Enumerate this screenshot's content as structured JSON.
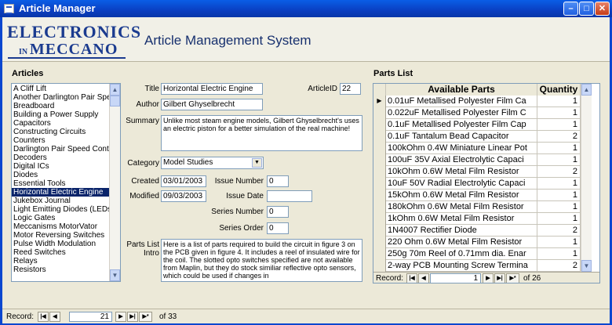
{
  "window": {
    "title": "Article Manager"
  },
  "header": {
    "logo_line1": "ELECTRONICS",
    "logo_in": "IN",
    "logo_line2": "MECCANO",
    "app_title": "Article Management System"
  },
  "articles": {
    "heading": "Articles",
    "items": [
      "A Cliff Lift",
      "Another Darlington Pair Speed",
      "Breadboard",
      "Building a Power Supply",
      "Capacitors",
      "Constructing Circuits",
      "Counters",
      "Darlington Pair Speed Control",
      "Decoders",
      "Digital ICs",
      "Diodes",
      "Essential Tools",
      "Horizontal Electric Engine",
      "Jukebox Journal",
      "Light Emitting Diodes (LEDs)",
      "Logic Gates",
      "Meccanisms MotorVator",
      "Motor Reversing Switches",
      "Pulse Width Modulation",
      "Reed Switches",
      "Relays",
      "Resistors"
    ],
    "selected_index": 12
  },
  "form": {
    "title_label": "Title",
    "title_value": "Horizontal Electric Engine",
    "articleid_label": "ArticleID",
    "articleid_value": "22",
    "author_label": "Author",
    "author_value": "Gilbert Ghyselbrecht",
    "summary_label": "Summary",
    "summary_value": "Unlike most steam engine models, Gilbert Ghyselbrecht's uses an electric piston for a better simulation of the real machine!",
    "category_label": "Category",
    "category_value": "Model Studies",
    "created_label": "Created",
    "created_value": "03/01/2003",
    "issue_number_label": "Issue Number",
    "issue_number_value": "0",
    "modified_label": "Modified",
    "modified_value": "09/03/2003",
    "issue_date_label": "Issue Date",
    "issue_date_value": "",
    "series_number_label": "Series Number",
    "series_number_value": "0",
    "series_order_label": "Series Order",
    "series_order_value": "0",
    "parts_intro_label1": "Parts List",
    "parts_intro_label2": "Intro",
    "parts_intro_value": "Here is a list of parts required to build the circuit in figure 3 on the PCB given in figure 4. It includes a reel of insulated wire for the coil. The slotted opto switches specified are not available from Maplin, but they do stock similiar reflective opto sensors, which could be used if changes in"
  },
  "parts": {
    "heading": "Parts List",
    "col_parts": "Available Parts",
    "col_qty": "Quantity",
    "rows": [
      {
        "name": "0.01uF Metallised Polyester Film Ca",
        "qty": "1"
      },
      {
        "name": "0.022uF Metallised Polyester Film C",
        "qty": "1"
      },
      {
        "name": "0.1uF Metallised Polyester Film Cap",
        "qty": "1"
      },
      {
        "name": "0.1uF Tantalum Bead Capacitor",
        "qty": "2"
      },
      {
        "name": "100kOhm 0.4W Miniature Linear Pot",
        "qty": "1"
      },
      {
        "name": "100uF 35V Axial Electrolytic Capaci",
        "qty": "1"
      },
      {
        "name": "10kOhm 0.6W Metal Film Resistor",
        "qty": "2"
      },
      {
        "name": "10uF 50V Radial Electrolytic Capaci",
        "qty": "1"
      },
      {
        "name": "15kOhm 0.6W Metal Film Resistor",
        "qty": "1"
      },
      {
        "name": "180kOhm 0.6W Metal Film Resistor",
        "qty": "1"
      },
      {
        "name": "1kOhm 0.6W Metal Film Resistor",
        "qty": "1"
      },
      {
        "name": "1N4007 Rectifier Diode",
        "qty": "2"
      },
      {
        "name": "220 Ohm 0.6W Metal Film Resistor",
        "qty": "1"
      },
      {
        "name": "250g 70m Reel of 0.71mm dia. Enar",
        "qty": "1"
      },
      {
        "name": "2-way PCB Mounting Screw Termina",
        "qty": "2"
      }
    ],
    "nav": {
      "label": "Record:",
      "current": "1",
      "total": "of  26"
    }
  },
  "main_nav": {
    "label": "Record:",
    "current": "21",
    "total": "of  33"
  }
}
